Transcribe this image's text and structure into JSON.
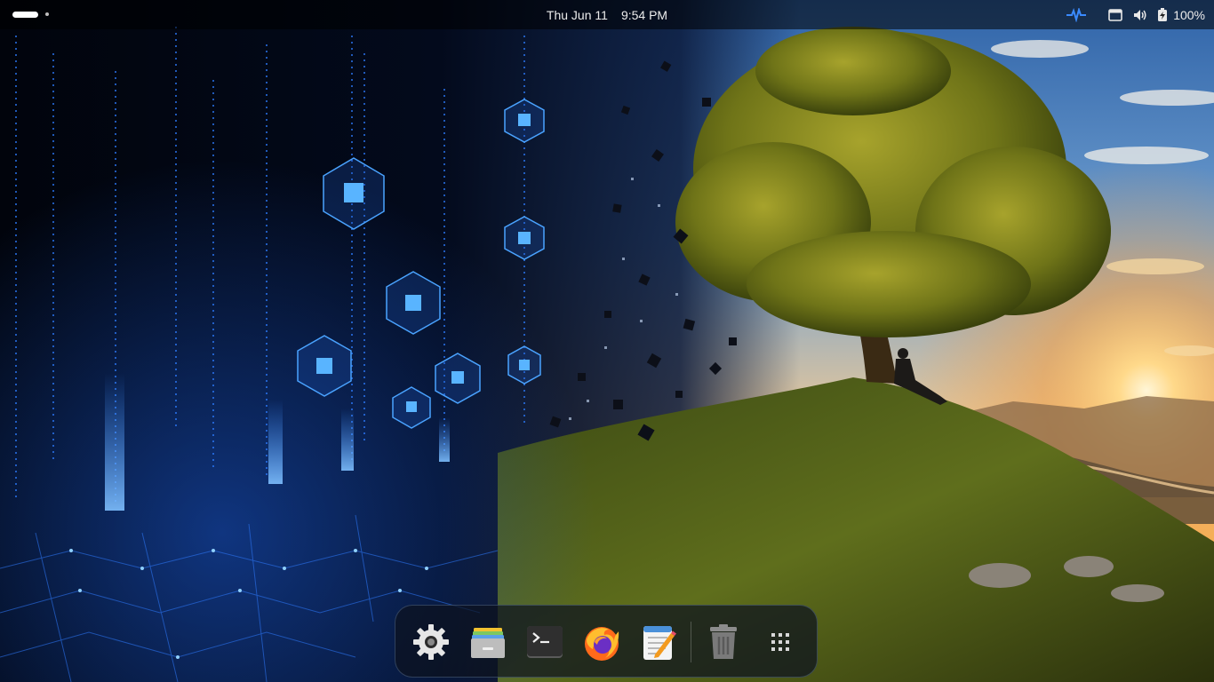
{
  "top_bar": {
    "date": "Thu Jun 11",
    "time": "9:54 PM",
    "battery_percent": "100%",
    "tray_icons": [
      "network-activity-icon",
      "screen-icon",
      "volume-icon",
      "battery-icon"
    ]
  },
  "dock": {
    "apps": [
      {
        "name": "Settings",
        "icon": "gear-icon"
      },
      {
        "name": "Files",
        "icon": "files-icon"
      },
      {
        "name": "Terminal",
        "icon": "terminal-icon"
      },
      {
        "name": "Firefox",
        "icon": "firefox-icon"
      },
      {
        "name": "Text Editor",
        "icon": "text-editor-icon"
      },
      {
        "name": "Trash",
        "icon": "trash-icon"
      },
      {
        "name": "Show Apps",
        "icon": "app-grid-icon"
      }
    ]
  },
  "colors": {
    "accent": "#3a8bff",
    "panel": "#000000",
    "sky_warm": "#f7b45a"
  }
}
